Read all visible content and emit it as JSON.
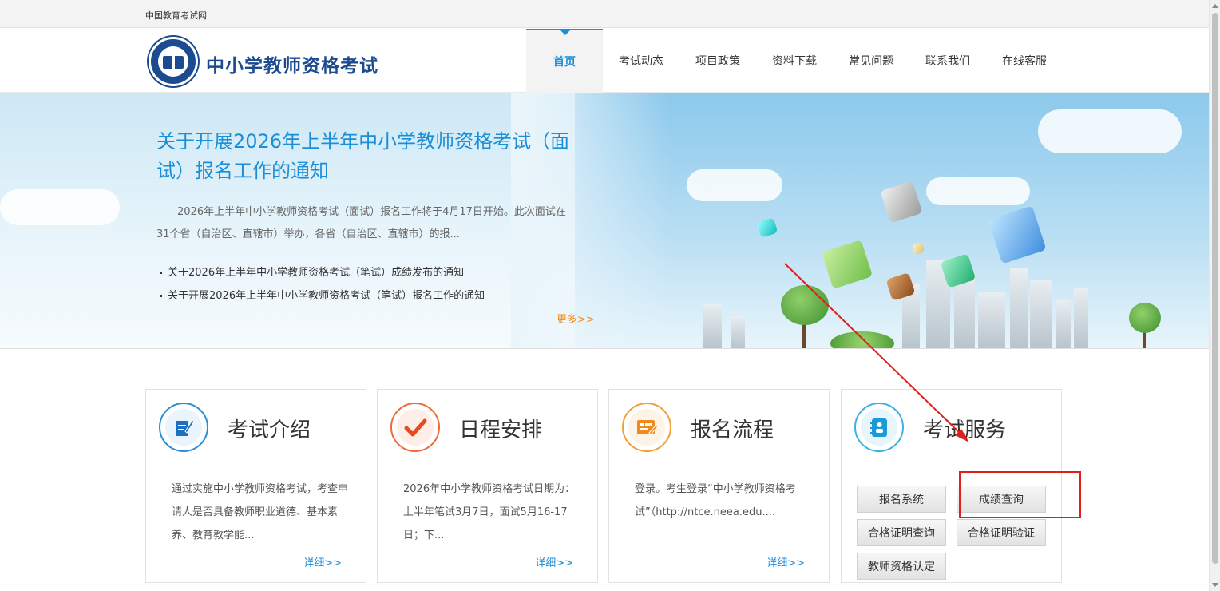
{
  "topbar": {
    "site_name": "中国教育考试网"
  },
  "header": {
    "logo_text": "中小学教师资格考试",
    "nav": [
      {
        "label": "首页"
      },
      {
        "label": "考试动态"
      },
      {
        "label": "项目政策"
      },
      {
        "label": "资料下载"
      },
      {
        "label": "常见问题"
      },
      {
        "label": "联系我们"
      },
      {
        "label": "在线客服"
      }
    ]
  },
  "banner": {
    "title": "关于开展2026年上半年中小学教师资格考试（面试）报名工作的通知",
    "summary": "2026年上半年中小学教师资格考试（面试）报名工作将于4月17日开始。此次面试在31个省（自治区、直辖市）举办，各省（自治区、直辖市）的报...",
    "links": [
      "关于2026年上半年中小学教师资格考试（笔试）成绩发布的通知",
      "关于开展2026年上半年中小学教师资格考试（笔试）报名工作的通知"
    ],
    "more": "更多>>"
  },
  "cards": [
    {
      "title": "考试介绍",
      "text": "通过实施中小学教师资格考试，考查申请人是否具备教师职业道德、基本素养、教育教学能...",
      "more": "详细>>",
      "icon": "document-edit-icon"
    },
    {
      "title": "日程安排",
      "text": "2026年中小学教师资格考试日期为：上半年笔试3月7日，面试5月16-17日；下...",
      "more": "详细>>",
      "icon": "checkmark-icon"
    },
    {
      "title": "报名流程",
      "text": "登录。考生登录“中小学教师资格考试”（http://ntce.neea.edu....",
      "more": "详细>>",
      "icon": "form-edit-icon"
    },
    {
      "title": "考试服务",
      "icon": "address-book-icon",
      "buttons": [
        "报名系统",
        "成绩查询",
        "合格证明查询",
        "合格证明验证",
        "教师资格认定"
      ]
    }
  ],
  "colors": {
    "accent": "#1a8fd8",
    "annotation": "#e0201c",
    "more_orange": "#f08a1c",
    "logo_navy": "#1d4b8f"
  }
}
